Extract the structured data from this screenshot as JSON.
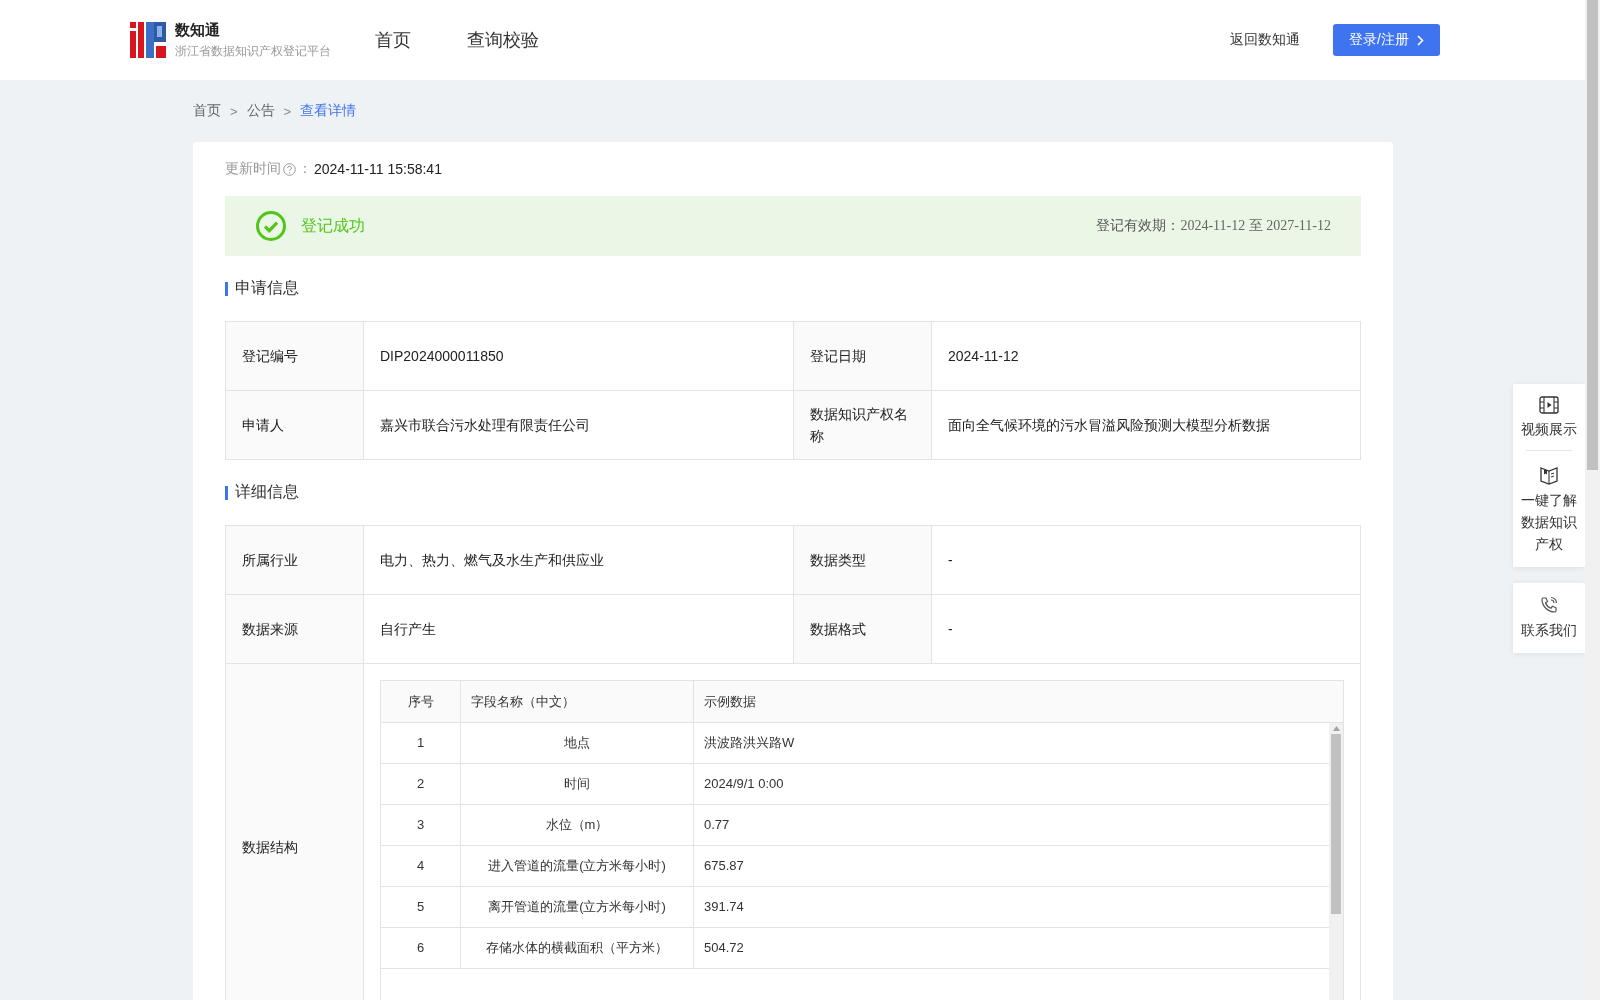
{
  "header": {
    "logo_title": "数知通",
    "logo_subtitle": "浙江省数据知识产权登记平台",
    "nav": [
      {
        "label": "首页"
      },
      {
        "label": "查询校验"
      }
    ],
    "back_link": "返回数知通",
    "login_button": "登录/注册"
  },
  "breadcrumb": [
    {
      "label": "首页",
      "current": false
    },
    {
      "label": "公告",
      "current": false
    },
    {
      "label": "查看详情",
      "current": true
    }
  ],
  "breadcrumb_separator": ">",
  "update_time": {
    "label": "更新时间",
    "colon": "：",
    "value": "2024-11-11 15:58:41"
  },
  "status": {
    "text": "登记成功",
    "validity_label": "登记有效期：",
    "validity_value": "2024-11-12 至 2027-11-12"
  },
  "sections": [
    {
      "title": "申请信息",
      "rows": [
        {
          "cells": [
            {
              "label": "登记编号",
              "value": "DIP2024000011850"
            },
            {
              "label": "登记日期",
              "value": "2024-11-12"
            }
          ]
        },
        {
          "cells": [
            {
              "label": "申请人",
              "value": "嘉兴市联合污水处理有限责任公司"
            },
            {
              "label": "数据知识产权名称",
              "value": "面向全气候环境的污水冒溢风险预测大模型分析数据"
            }
          ]
        }
      ]
    },
    {
      "title": "详细信息",
      "rows": [
        {
          "cells": [
            {
              "label": "所属行业",
              "value": "电力、热力、燃气及水生产和供应业"
            },
            {
              "label": "数据类型",
              "value": "-"
            }
          ]
        },
        {
          "cells": [
            {
              "label": "数据来源",
              "value": "自行产生"
            },
            {
              "label": "数据格式",
              "value": "-"
            }
          ]
        }
      ],
      "structure": {
        "label": "数据结构",
        "columns": [
          "序号",
          "字段名称（中文）",
          "示例数据"
        ],
        "rows": [
          [
            "1",
            "地点",
            "洪波路洪兴路W"
          ],
          [
            "2",
            "时间",
            "2024/9/1 0:00"
          ],
          [
            "3",
            "水位（m）",
            "0.77"
          ],
          [
            "4",
            "进入管道的流量(立方米每小时)",
            "675.87"
          ],
          [
            "5",
            "离开管道的流量(立方米每小时)",
            "391.74"
          ],
          [
            "6",
            "存储水体的横截面积（平方米）",
            "504.72"
          ]
        ]
      }
    }
  ],
  "side_panel": [
    {
      "kind": "video",
      "label": "视频展示"
    },
    {
      "kind": "guide",
      "label": "一键了解数据知识产权"
    }
  ],
  "contact": {
    "kind": "phone",
    "label": "联系我们"
  }
}
